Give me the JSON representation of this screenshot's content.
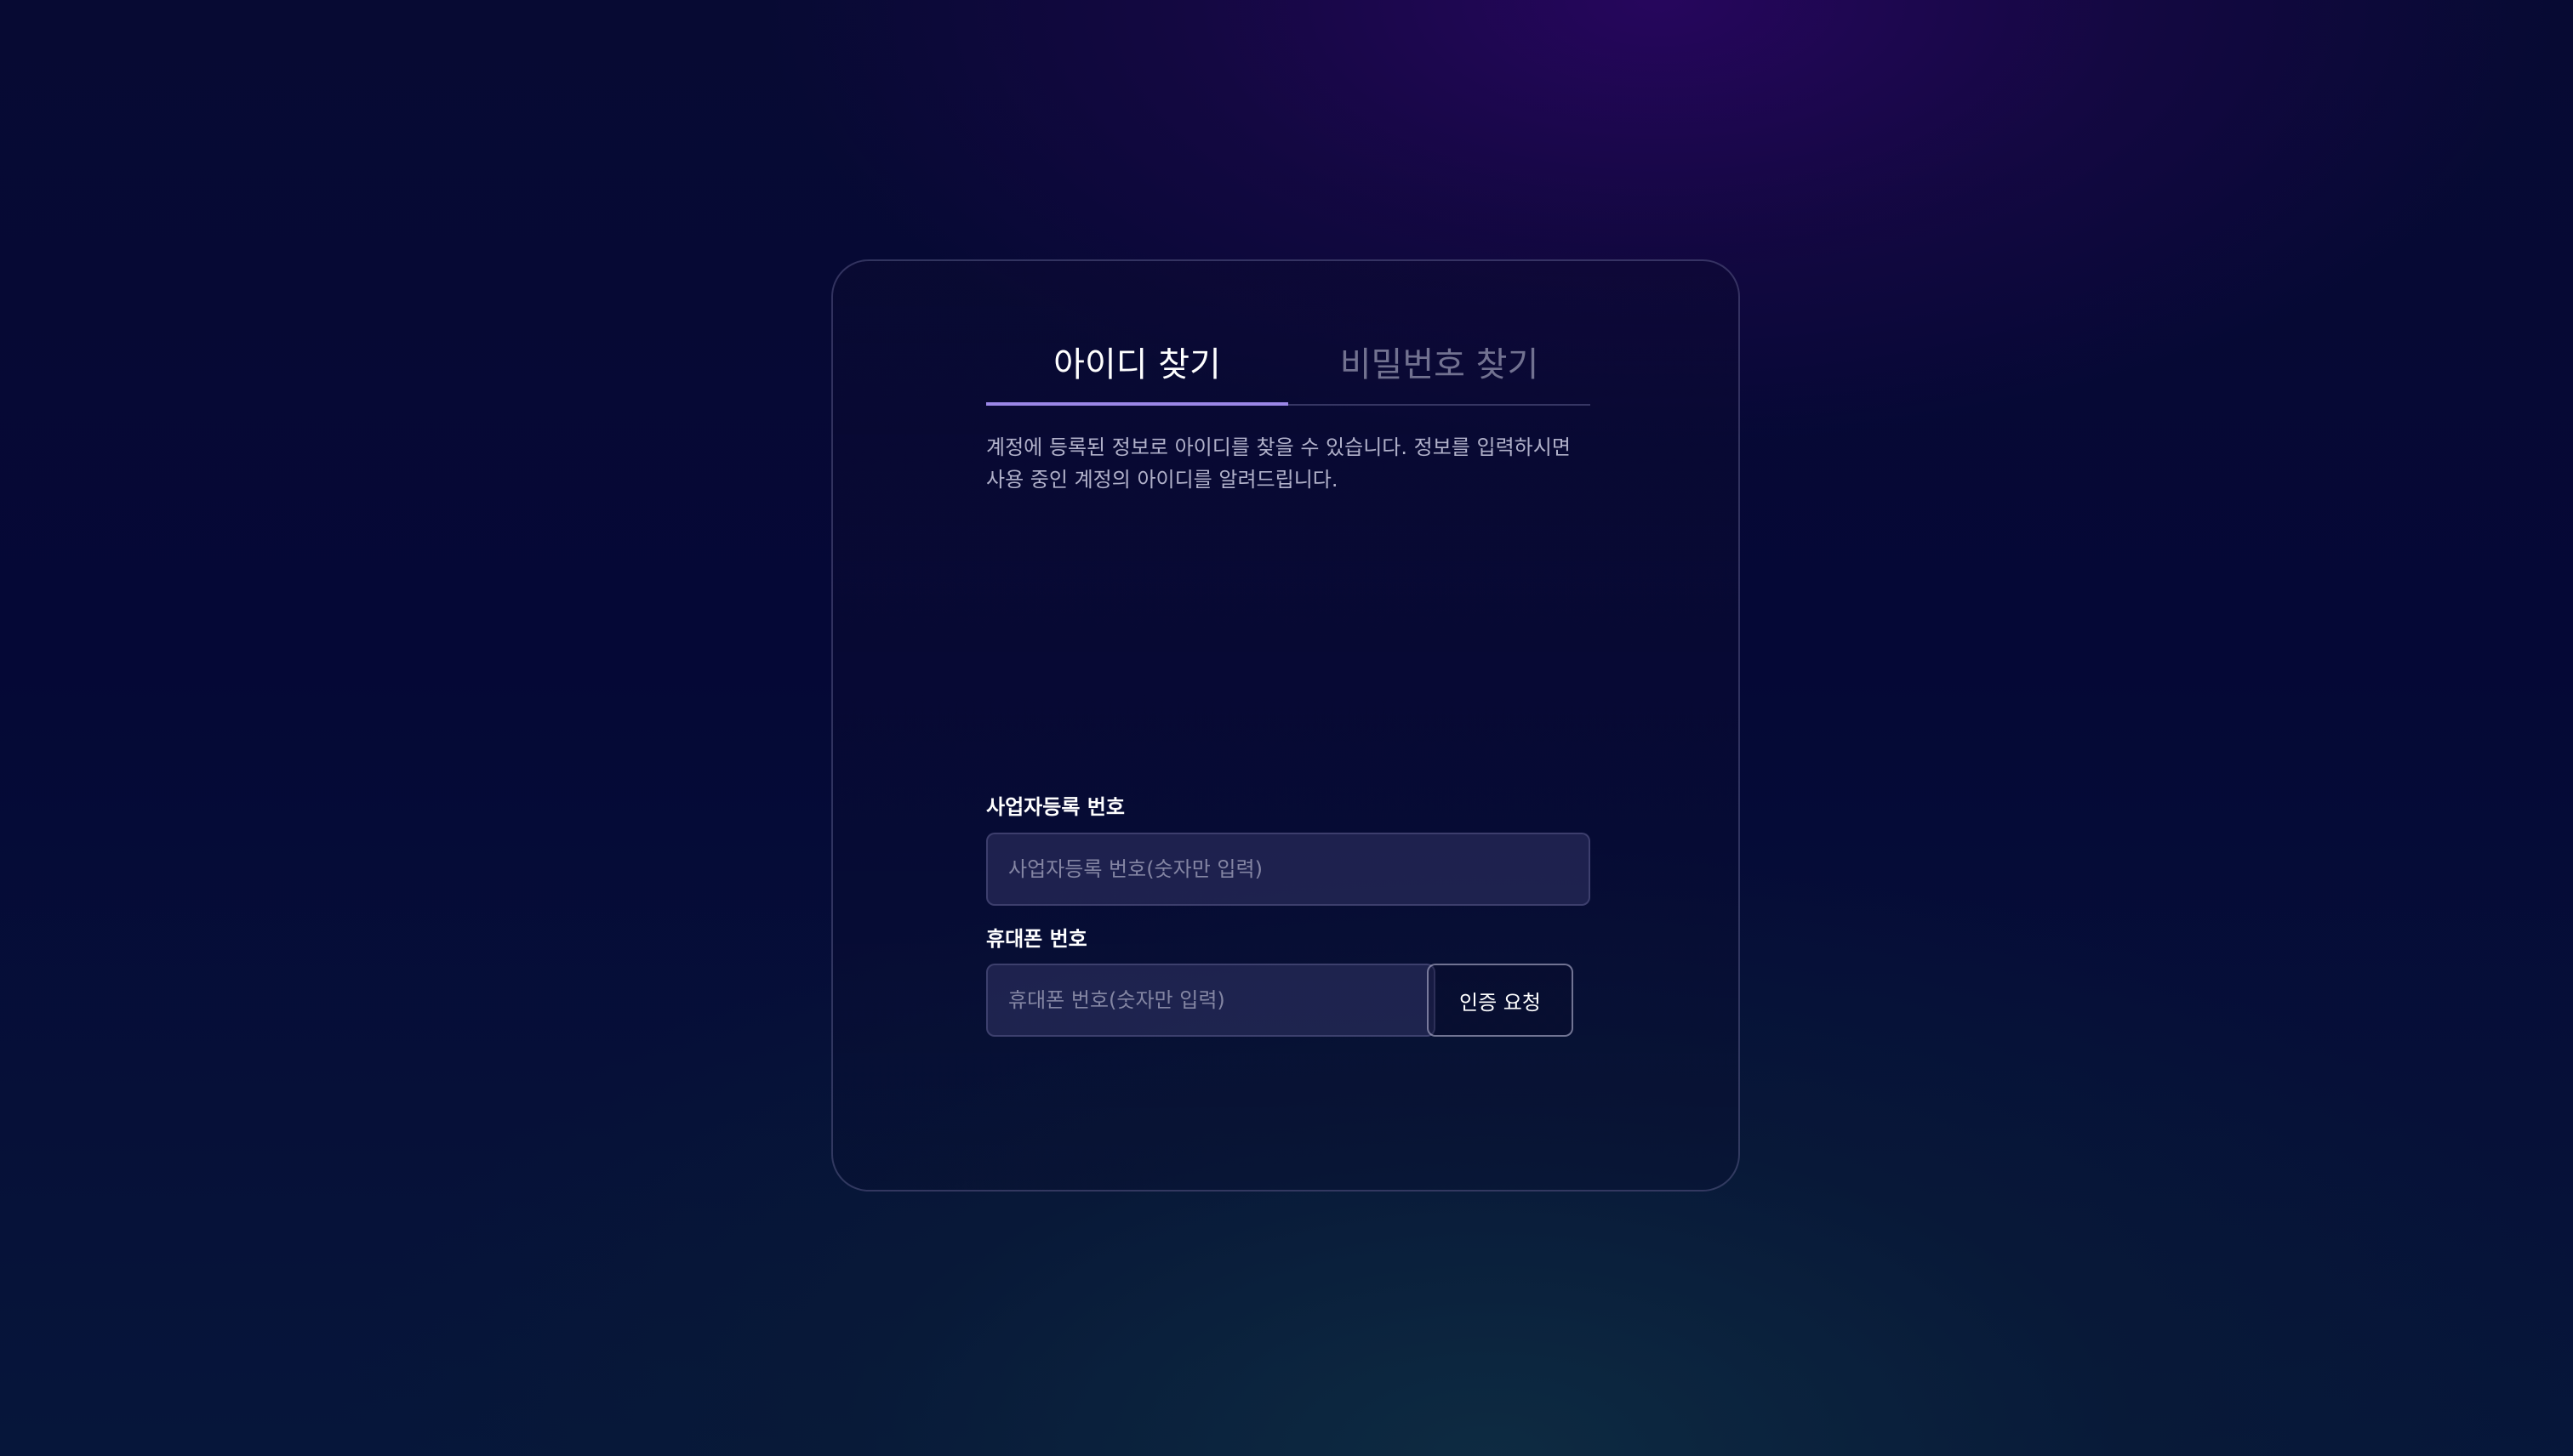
{
  "tabs": [
    {
      "label": "아이디 찾기",
      "active": true
    },
    {
      "label": "비밀번호 찾기",
      "active": false
    }
  ],
  "description": "계정에 등록된 정보로 아이디를 찾을 수 있습니다. 정보를 입력하시면 사용 중인 계정의 아이디를 알려드립니다.",
  "business_number": {
    "label": "사업자등록 번호",
    "placeholder": "사업자등록 번호(숫자만 입력)",
    "value": ""
  },
  "phone": {
    "label": "휴대폰 번호",
    "placeholder": "휴대폰 번호(숫자만 입력)",
    "value": ""
  },
  "verify_button": {
    "label": "인증 요청"
  },
  "colors": {
    "accent": "#9b87e8"
  }
}
